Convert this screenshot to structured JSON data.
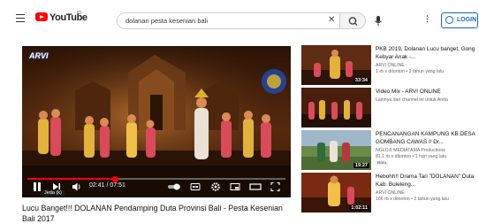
{
  "header": {
    "logo_text": "YouTube",
    "logo_sup": "ID",
    "search_value": "dolanan pesta kesenian bali",
    "login_label": "LOGIN"
  },
  "player": {
    "channel_logo_text": "ARVI",
    "time_display": "02:41 / 07:51",
    "progress_fraction": 0.342,
    "tooltip": "Jeda (k)"
  },
  "video": {
    "title": "Lucu Banget!!! DOLANAN Pendamping Duta Provinsi Bali - Pesta Kesenian Bali 2017"
  },
  "recommendations": [
    {
      "title": "PKB 2019, Dolanan Lucu banget, Gong Kebyar Anak -...",
      "channel": "ARVI ONLINE",
      "meta": "1 rb x ditonton • 2 tahun yang lalu",
      "duration": "33:34",
      "badge": ""
    },
    {
      "title": "Video Mix - ARVI ONLINE",
      "channel": "Lainnya dari channel ini untuk Anda",
      "meta": "",
      "duration": "",
      "badge": ""
    },
    {
      "title": "PENCANANGAN KAMPUNG KB DESA GOMBANG CAWAS // Dr...",
      "channel": "NGLOJI MEDIATAMA Productions",
      "meta": "81,1 rb x ditonton • 1 hari yang lalu",
      "duration": "19:27",
      "badge": "Baru"
    },
    {
      "title": "Hebohh!! Drama Tari \"DOLANAN\" Duta Kab. Buleleng...",
      "channel": "ARVI ONLINE",
      "meta": "166 rb x ditonton • 2 tahun yang lalu",
      "duration": "1:02:11",
      "badge": ""
    }
  ],
  "colors": {
    "brand_red": "#ff0000",
    "login_blue": "#1565c0"
  }
}
